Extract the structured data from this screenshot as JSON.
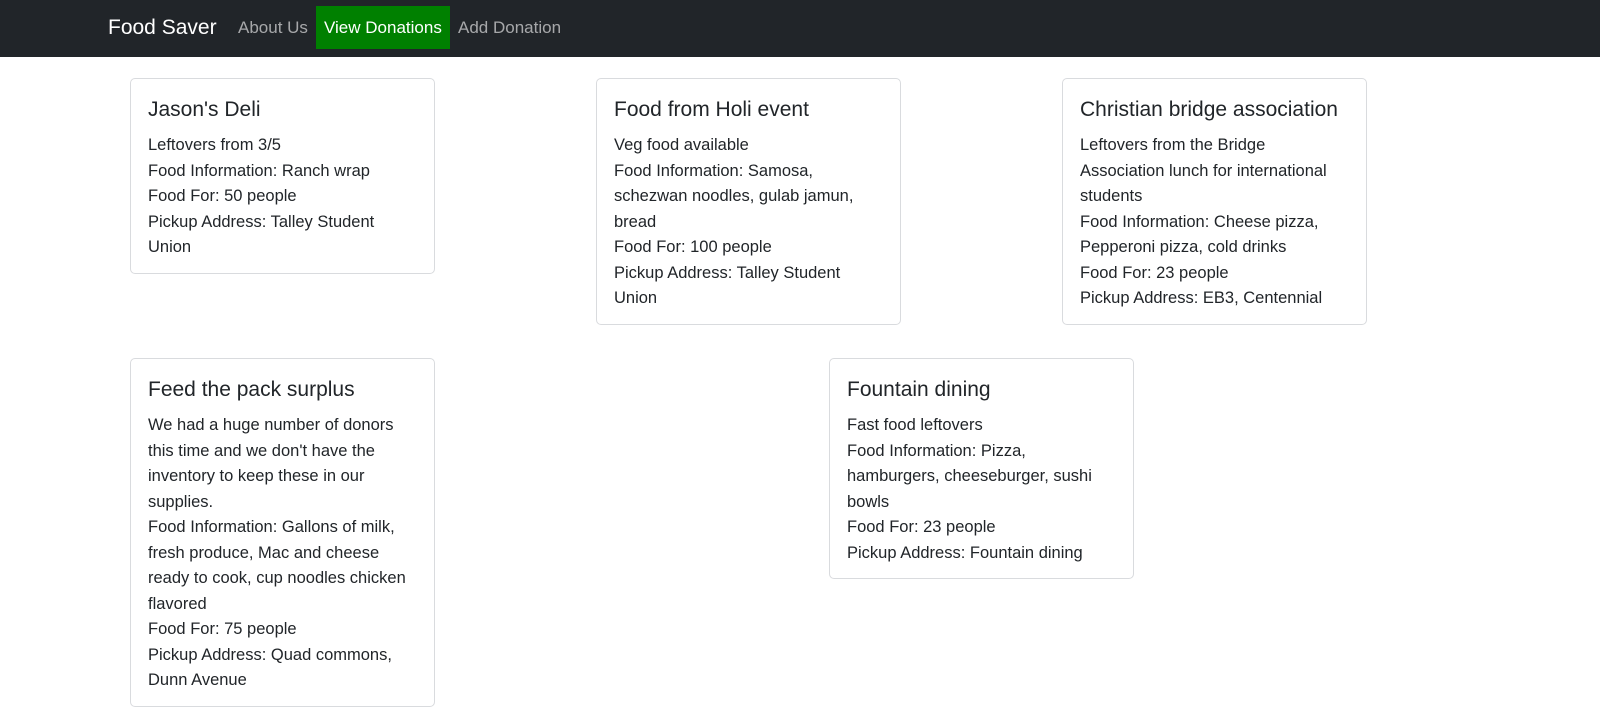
{
  "navbar": {
    "brand": "Food Saver",
    "links": [
      {
        "label": "About Us",
        "active": false
      },
      {
        "label": "View Donations",
        "active": true
      },
      {
        "label": "Add Donation",
        "active": false
      }
    ],
    "active_color": "#008000",
    "background": "#212529"
  },
  "donations": [
    {
      "title": "Jason's Deli",
      "description": "Leftovers from 3/5",
      "food_info": "Food Information: Ranch wrap",
      "food_for": "Food For: 50 people",
      "pickup": "Pickup Address: Talley Student Union"
    },
    {
      "title": "Food from Holi event",
      "description": "Veg food available",
      "food_info": "Food Information: Samosa, schezwan noodles, gulab jamun, bread",
      "food_for": "Food For: 100 people",
      "pickup": "Pickup Address: Talley Student Union"
    },
    {
      "title": "Christian bridge association",
      "description": "Leftovers from the Bridge Association lunch for international students",
      "food_info": "Food Information: Cheese pizza, Pepperoni pizza, cold drinks",
      "food_for": "Food For: 23 people",
      "pickup": "Pickup Address: EB3, Centennial"
    },
    {
      "title": "Feed the pack surplus",
      "description": "We had a huge number of donors this time and we don't have the inventory to keep these in our supplies.",
      "food_info": "Food Information: Gallons of milk, fresh produce, Mac and cheese ready to cook, cup noodles chicken flavored",
      "food_for": "Food For: 75 people",
      "pickup": "Pickup Address: Quad commons, Dunn Avenue"
    },
    {
      "title": "Fountain dining",
      "description": "Fast food leftovers",
      "food_info": "Food Information: Pizza, hamburgers, cheeseburger, sushi bowls",
      "food_for": "Food For: 23 people",
      "pickup": "Pickup Address: Fountain dining"
    }
  ]
}
